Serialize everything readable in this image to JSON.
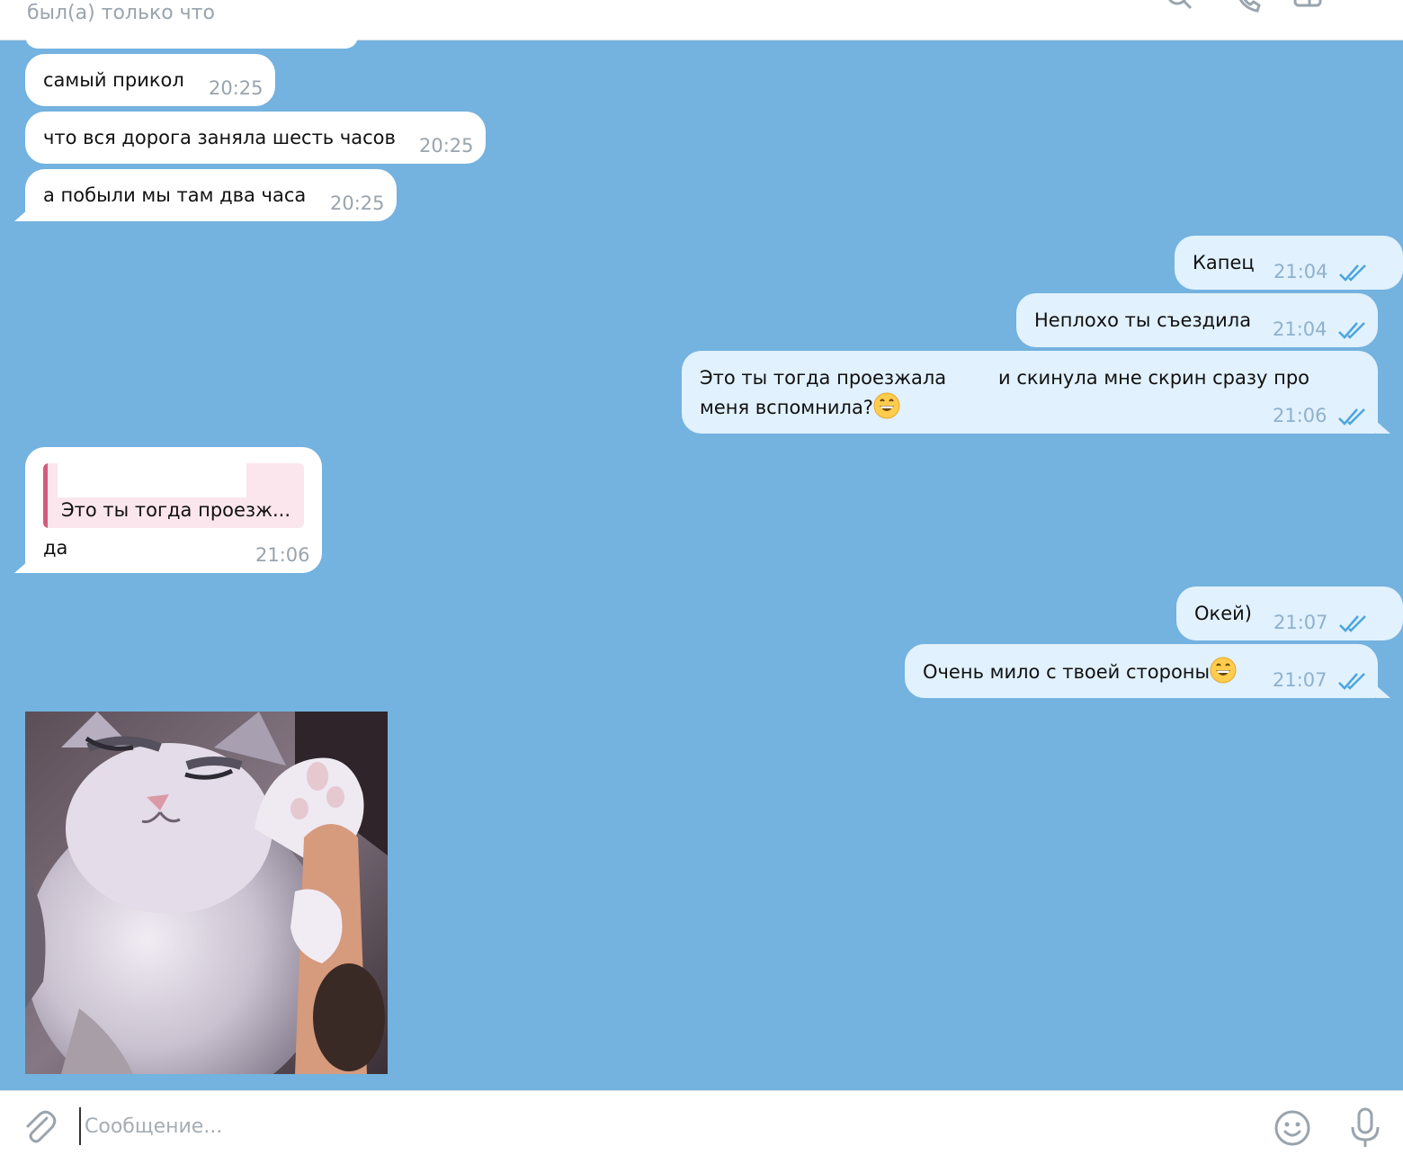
{
  "header": {
    "status": "был(а) только что",
    "icons": [
      "search-icon",
      "phone-icon",
      "sidebar-toggle-icon",
      "more-vertical-icon"
    ]
  },
  "messages": [
    {
      "direction": "in",
      "text": "самый прикол",
      "time": "20:25"
    },
    {
      "direction": "in",
      "text": "что вся дорога заняла шесть часов",
      "time": "20:25"
    },
    {
      "direction": "in",
      "text": "а побыли мы там два часа",
      "time": "20:25"
    },
    {
      "direction": "out",
      "text": "Капец",
      "time": "21:04",
      "read": true
    },
    {
      "direction": "out",
      "text": "Неплохо ты съездила",
      "time": "21:04",
      "read": true
    },
    {
      "direction": "out",
      "text_line1_part1": "Это ты тогда проезжала",
      "text_line1_part2": "и скинула мне скрин сразу про",
      "text_line2": "меня вспомнила?",
      "emoji": "grinning-face-emoji",
      "time": "21:06",
      "read": true
    },
    {
      "direction": "in",
      "reply_preview": "Это ты тогда проезж...",
      "text": "да",
      "time": "21:06"
    },
    {
      "direction": "out",
      "text": "Окей)",
      "time": "21:07",
      "read": true
    },
    {
      "direction": "out",
      "text": "Очень мило с твоей стороны",
      "emoji": "grinning-face-emoji",
      "time": "21:07",
      "read": true
    }
  ],
  "sticker": {
    "description_icon": "cat-sticker"
  },
  "composer": {
    "placeholder": "Сообщение...",
    "icons": [
      "attach-icon",
      "emoji-icon",
      "microphone-icon"
    ]
  },
  "colors": {
    "chat_background": "#74b2df",
    "incoming_bubble": "#ffffff",
    "outgoing_bubble": "#e1f1fd",
    "read_ticks": "#4aa6e0",
    "reply_bar": "#d15c7e"
  }
}
